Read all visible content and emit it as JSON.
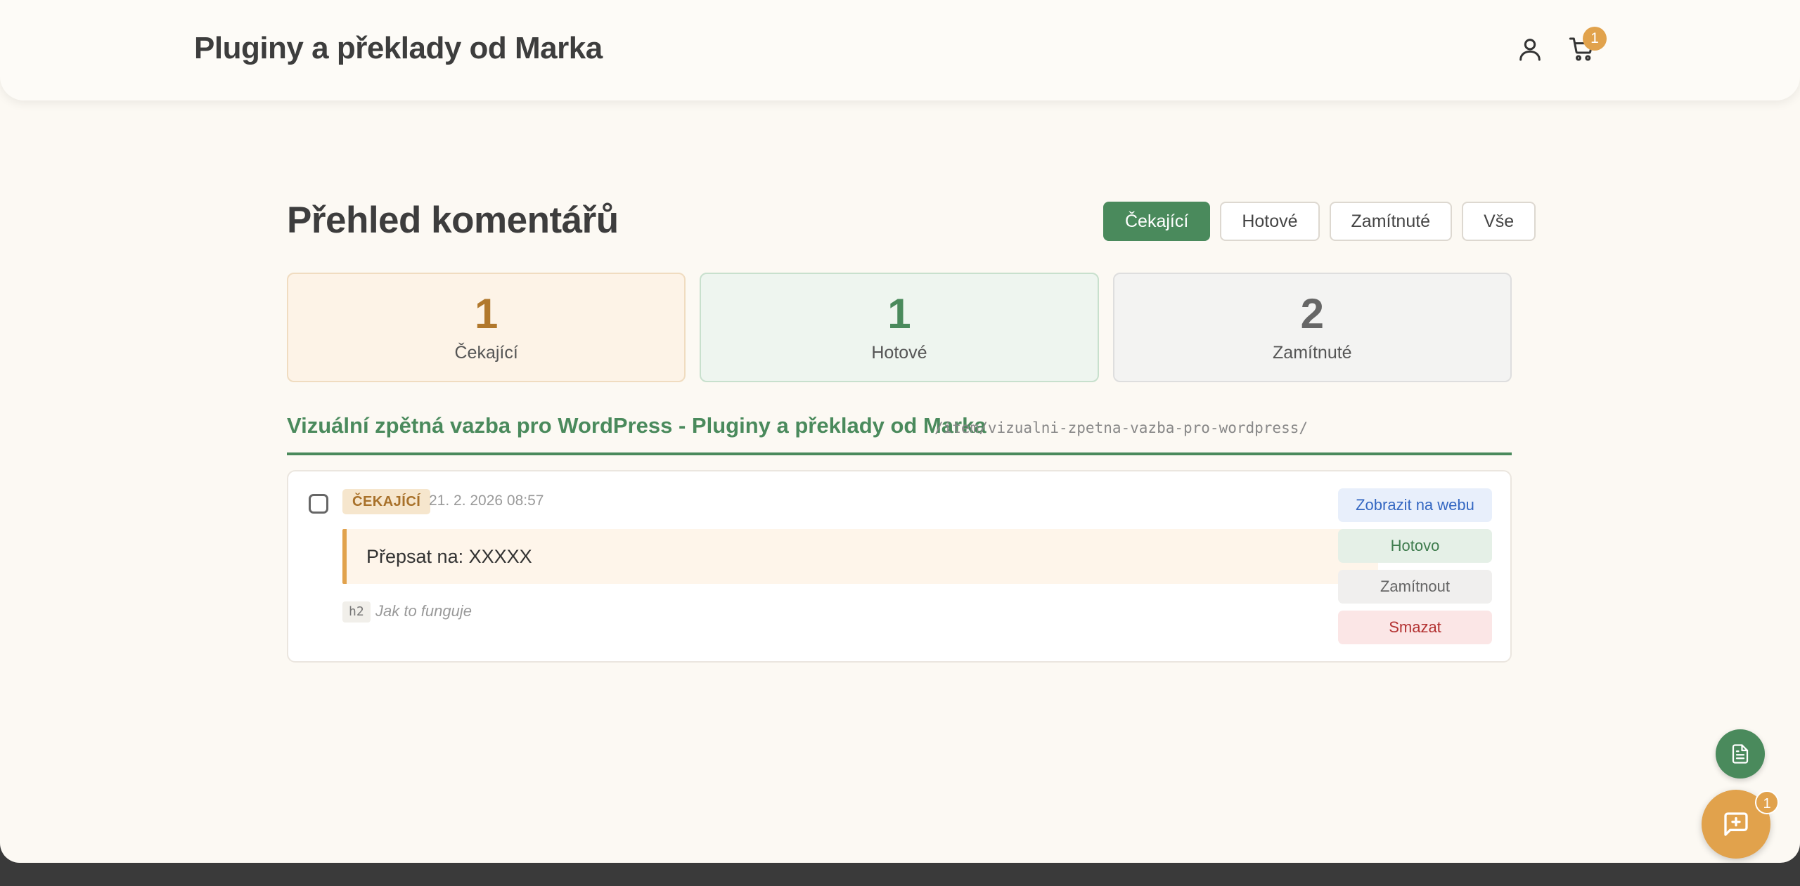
{
  "header": {
    "site_title": "Pluginy a překlady od Marka",
    "cart_count": "1"
  },
  "main": {
    "title": "Přehled komentářů",
    "filters": [
      {
        "label": "Čekající",
        "active": true
      },
      {
        "label": "Hotové",
        "active": false
      },
      {
        "label": "Zamítnuté",
        "active": false
      },
      {
        "label": "Vše",
        "active": false
      }
    ],
    "stats": [
      {
        "value": "1",
        "label": "Čekající"
      },
      {
        "value": "1",
        "label": "Hotové"
      },
      {
        "value": "2",
        "label": "Zamítnuté"
      }
    ],
    "page_group": {
      "title": "Vizuální zpětná vazba pro WordPress - Pluginy a překlady od Marka",
      "path": "/item/vizualni-zpetna-vazba-pro-wordpress/"
    },
    "comment": {
      "status": "ČEKAJÍCÍ",
      "date": "21. 2. 2026 08:57",
      "text": "Přepsat na: XXXXX",
      "element_tag": "h2",
      "element_text": "Jak to funguje",
      "actions": {
        "view": "Zobrazit na webu",
        "done": "Hotovo",
        "reject": "Zamítnout",
        "delete": "Smazat"
      }
    }
  },
  "fab": {
    "feedback_count": "1"
  },
  "colors": {
    "accent_green": "#4a8a5c",
    "accent_orange": "#e1a24c",
    "background": "#fcf9f3"
  }
}
